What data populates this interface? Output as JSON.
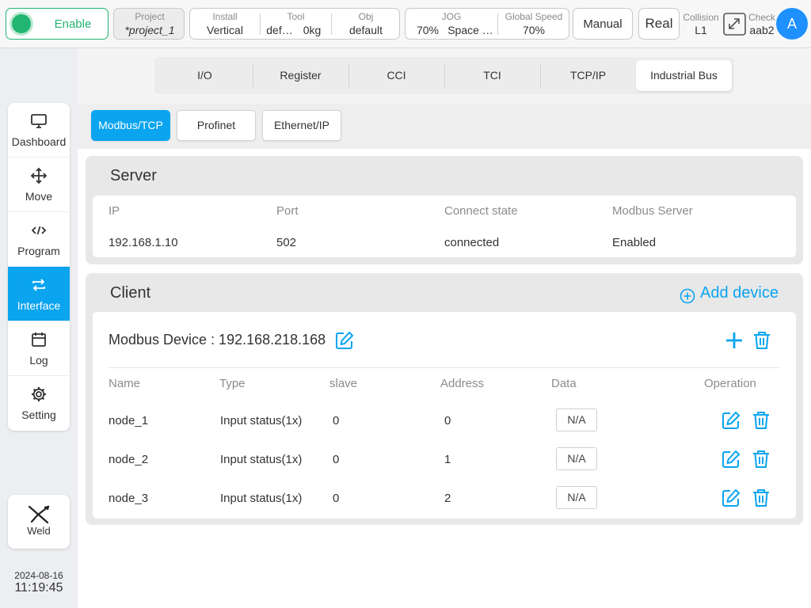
{
  "topbar": {
    "enable_label": "Enable",
    "project": {
      "caption": "Project",
      "value": "*project_1"
    },
    "install": {
      "caption": "Install",
      "value": "Vertical"
    },
    "tool": {
      "caption": "Tool",
      "value1": "def…",
      "value2": "0kg"
    },
    "obj": {
      "caption": "Obj",
      "value": "default"
    },
    "jog": {
      "caption": "JOG",
      "value1": "70%",
      "value2": "Space …"
    },
    "global_speed": {
      "caption": "Global Speed",
      "value": "70%"
    },
    "mode_label": "Manual",
    "real_label": "Real",
    "collision": {
      "caption": "Collision",
      "value": "L1"
    },
    "check": {
      "caption": "Check",
      "value": "aab2"
    },
    "avatar_letter": "A"
  },
  "sidebar": {
    "items": [
      {
        "label": "Dashboard",
        "icon": "monitor-icon"
      },
      {
        "label": "Move",
        "icon": "move-arrows-icon"
      },
      {
        "label": "Program",
        "icon": "code-icon"
      },
      {
        "label": "Interface",
        "icon": "swap-arrows-icon"
      },
      {
        "label": "Log",
        "icon": "calendar-icon"
      },
      {
        "label": "Setting",
        "icon": "gear-icon"
      }
    ],
    "active_index": 3,
    "weld_label": "Weld",
    "date": "2024-08-16",
    "time": "11:19:45"
  },
  "tabs": [
    {
      "label": "I/O"
    },
    {
      "label": "Register"
    },
    {
      "label": "CCI"
    },
    {
      "label": "TCI"
    },
    {
      "label": "TCP/IP"
    },
    {
      "label": "Industrial Bus"
    }
  ],
  "subtabs": [
    {
      "label": "Modbus/TCP"
    },
    {
      "label": "Profinet"
    },
    {
      "label": "Ethernet/IP"
    }
  ],
  "server": {
    "title": "Server",
    "headers": [
      "IP",
      "Port",
      "Connect state",
      "Modbus Server"
    ],
    "row": [
      "192.168.1.10",
      "502",
      "connected",
      "Enabled"
    ]
  },
  "client": {
    "title": "Client",
    "add_device_label": "Add device",
    "device_title": "Modbus Device : 192.168.218.168",
    "headers": [
      "Name",
      "Type",
      "slave",
      "Address",
      "Data",
      "Operation"
    ],
    "rows": [
      {
        "name": "node_1",
        "type": "Input status(1x)",
        "slave": "0",
        "address": "0",
        "data": "N/A"
      },
      {
        "name": "node_2",
        "type": "Input status(1x)",
        "slave": "0",
        "address": "1",
        "data": "N/A"
      },
      {
        "name": "node_3",
        "type": "Input status(1x)",
        "slave": "0",
        "address": "2",
        "data": "N/A"
      }
    ]
  },
  "colors": {
    "accent": "#0aa4ef",
    "enable": "#22b573",
    "avatar": "#1e90ff"
  }
}
